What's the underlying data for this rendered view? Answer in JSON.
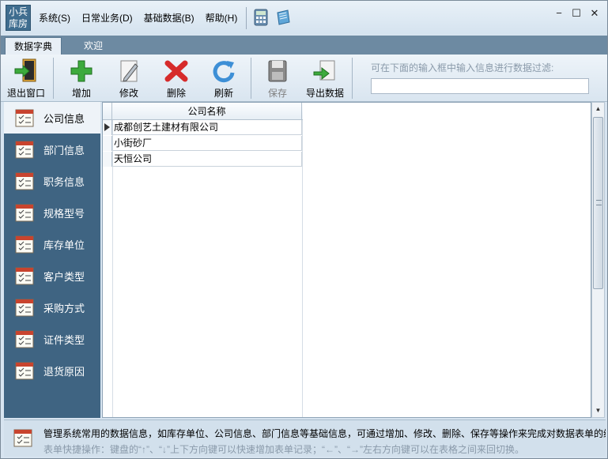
{
  "app": {
    "logo_line1": "小兵",
    "logo_line2": "库房"
  },
  "menu": [
    {
      "label": "系统(S)"
    },
    {
      "label": "日常业务(D)"
    },
    {
      "label": "基础数据(B)"
    },
    {
      "label": "帮助(H)"
    }
  ],
  "window_controls": {
    "minimize": "−",
    "maximize": "☐",
    "close": "✕"
  },
  "tabs": [
    {
      "label": "数据字典",
      "active": true
    },
    {
      "label": "欢迎",
      "active": false
    }
  ],
  "toolbar": {
    "exit": "退出窗口",
    "add": "增加",
    "edit": "修改",
    "delete": "删除",
    "refresh": "刷新",
    "save": "保存",
    "export": "导出数据",
    "filter_hint": "可在下面的输入框中输入信息进行数据过滤:",
    "filter_value": ""
  },
  "nav": [
    {
      "label": "公司信息",
      "active": true
    },
    {
      "label": "部门信息"
    },
    {
      "label": "职务信息"
    },
    {
      "label": "规格型号"
    },
    {
      "label": "库存单位"
    },
    {
      "label": "客户类型"
    },
    {
      "label": "采购方式"
    },
    {
      "label": "证件类型"
    },
    {
      "label": "退货原因"
    }
  ],
  "grid": {
    "column": "公司名称",
    "rows": [
      "成都创艺土建材有限公司",
      "小街砂厂",
      "天恒公司"
    ]
  },
  "info": {
    "line1": "管理系统常用的数据信息，如库存单位、公司信息、部门信息等基础信息，可通过增加、修改、删除、保存等操作来完成对数据表单的维护。",
    "line2": "表单快捷操作：键盘的“↑”、“↓”上下方向键可以快速增加表单记录；“←”、“→”左右方向键可以在表格之间来回切换。"
  },
  "colors": {
    "nav_bg": "#3f6482",
    "tab_bar": "#6d8aa2",
    "window_bg": "#d7e4f0"
  }
}
